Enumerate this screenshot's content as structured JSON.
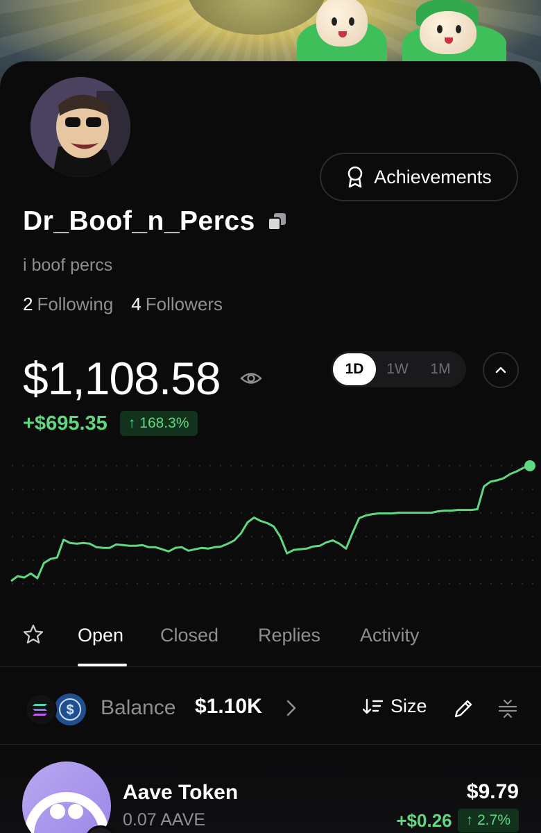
{
  "profile": {
    "username": "Dr_Boof_n_Percs",
    "bio": "i boof percs",
    "following_count": "2",
    "following_label": "Following",
    "followers_count": "4",
    "followers_label": "Followers",
    "achievements_label": "Achievements"
  },
  "portfolio": {
    "balance": "$1,108.58",
    "pnl_value": "+$695.35",
    "pnl_percent": "168.3%",
    "ranges": [
      "1D",
      "1W",
      "1M"
    ],
    "active_range": "1D"
  },
  "tabs": {
    "open": "Open",
    "closed": "Closed",
    "replies": "Replies",
    "activity": "Activity"
  },
  "balance_bar": {
    "label": "Balance",
    "value": "$1.10K",
    "sort_label": "Size"
  },
  "positions": [
    {
      "name": "Aave Token",
      "amount": "0.07 AAVE",
      "value": "$9.79",
      "change_value": "+$0.26",
      "change_percent": "2.7%"
    }
  ],
  "colors": {
    "positive": "#5fd87f",
    "positive_bg": "#12321d",
    "background": "#0b0b0c",
    "muted": "#8e8e93"
  },
  "icons": {
    "eye": "eye-icon",
    "copy": "copy-icon",
    "ribbon": "award-icon",
    "star": "star-icon",
    "chevron": "chevron-right-icon",
    "sort": "sort-icon",
    "edit": "pencil-icon",
    "compact": "compact-icon"
  },
  "chart_data": {
    "type": "line",
    "y": [
      1,
      8,
      6,
      12,
      5,
      27,
      33,
      35,
      61,
      56,
      55,
      56,
      55,
      50,
      49,
      49,
      54,
      53,
      52,
      52,
      53,
      50,
      50,
      47,
      44,
      49,
      50,
      45,
      47,
      49,
      48,
      50,
      51,
      55,
      60,
      70,
      86,
      93,
      88,
      85,
      80,
      65,
      41,
      46,
      47,
      48,
      51,
      52,
      57,
      60,
      55,
      48,
      71,
      92,
      96,
      98,
      99,
      99,
      99,
      100,
      100,
      100,
      100,
      100,
      100,
      102,
      103,
      103,
      104,
      104,
      104,
      105,
      138,
      145,
      147,
      150,
      156,
      160,
      165,
      168
    ]
  }
}
